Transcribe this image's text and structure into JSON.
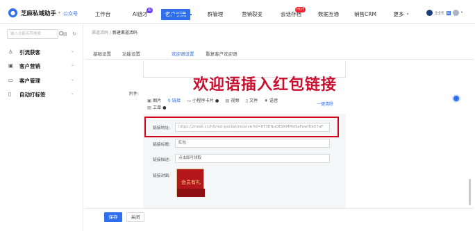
{
  "brand": {
    "name": "芝麻私域助手",
    "account": "公众号"
  },
  "nav": {
    "items": [
      {
        "label": "工作台"
      },
      {
        "label": "AI选才",
        "badge": "AI"
      },
      {
        "label": "客户引流"
      },
      {
        "label": "群管理"
      },
      {
        "label": "营销裂变"
      },
      {
        "label": "会话存档",
        "badge": "HOT"
      },
      {
        "label": "数据互通"
      },
      {
        "label": "销售CRM"
      },
      {
        "label": "更多"
      }
    ],
    "active_index": 2
  },
  "top_right": {
    "text1": "企业名",
    "text2": "试"
  },
  "sidebar": {
    "search_placeholder": "输入功能名称搜索",
    "items": [
      {
        "label": "引流获客",
        "icon": "user-plus-icon"
      },
      {
        "label": "客户营销",
        "icon": "calendar-icon"
      },
      {
        "label": "客户管理",
        "icon": "folder-icon"
      },
      {
        "label": "自动打标签",
        "icon": "tag-icon"
      }
    ]
  },
  "breadcrumb": {
    "parent": "渠道活码",
    "sep": "/",
    "current": "新建渠道活码"
  },
  "tabs": [
    "基础设置",
    "功能设置",
    "欢迎语设置",
    "重复客户欢迎语"
  ],
  "active_tab": 2,
  "banner": "欢迎语插入红包链接",
  "attachment": {
    "label": "附件:",
    "tools": [
      "图片",
      "链接",
      "小程序卡片",
      "视频",
      "文件",
      "语音"
    ],
    "tool2": "工单",
    "clear": "一键清除"
  },
  "link_form": {
    "url_label": "链接地址:",
    "url_value": "https://zmwk.cn/h5/red-packet/receive?id=8T3ENuDESKMMdSaFuwHtk57aF",
    "title_label": "链接标题:",
    "title_value": "红包",
    "desc_label": "链接描述:",
    "desc_value": "点击即可领取",
    "cover_label": "链接封面:",
    "cover_text": "会员有礼"
  },
  "footer": {
    "save": "保存",
    "close": "关闭"
  },
  "colors": {
    "primary": "#2f6fed",
    "highlight": "#d0021b",
    "banner": "#c8102e"
  }
}
